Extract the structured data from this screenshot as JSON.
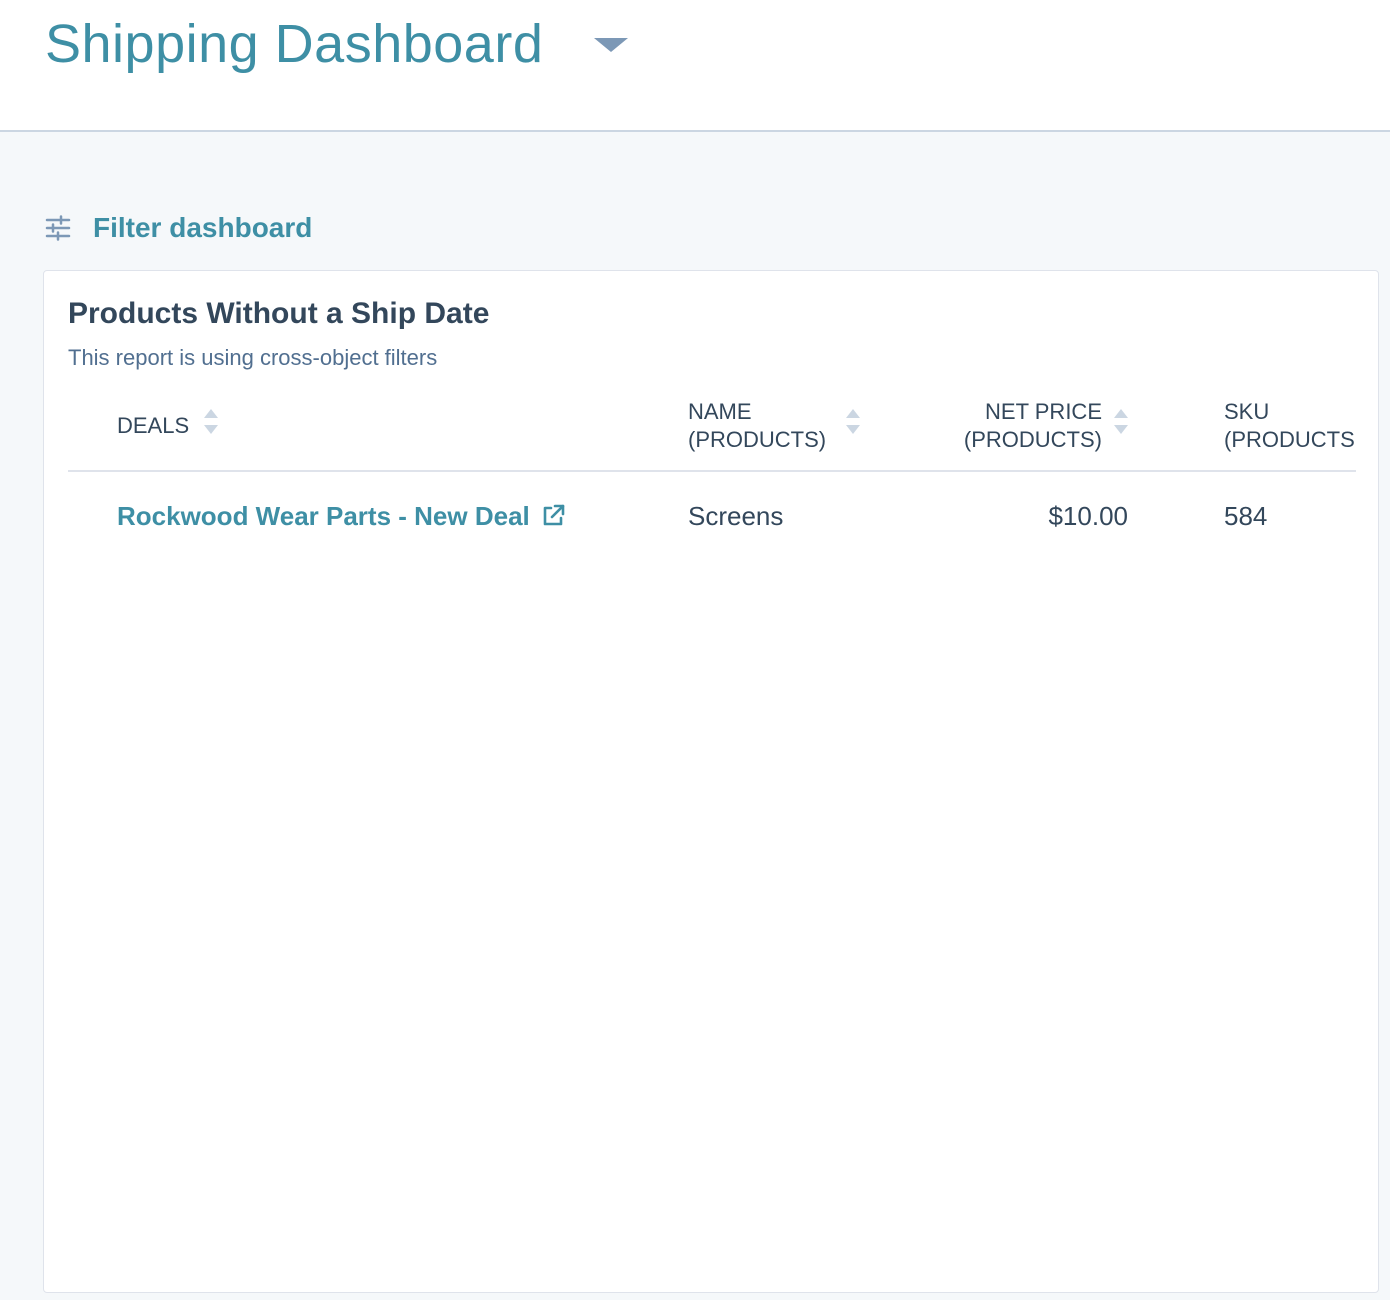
{
  "header": {
    "title": "Shipping Dashboard"
  },
  "filter": {
    "label": "Filter dashboard"
  },
  "report": {
    "title": "Products Without a Ship Date",
    "subtitle": "This report is using cross-object filters",
    "columns": [
      {
        "line1": "DEALS",
        "line2": ""
      },
      {
        "line1": "NAME",
        "line2": "(PRODUCTS)"
      },
      {
        "line1": "NET PRICE",
        "line2": "(PRODUCTS)"
      },
      {
        "line1": "SKU",
        "line2": "(PRODUCTS)"
      }
    ],
    "rows": [
      {
        "deal": "Rockwood Wear Parts - New Deal",
        "name": "Screens",
        "net_price": "$10.00",
        "sku": "584"
      }
    ]
  },
  "colors": {
    "accent": "#3e8fa5",
    "text": "#33475b",
    "muted": "#516f90",
    "border": "#dfe3eb",
    "background": "#f5f8fa"
  }
}
